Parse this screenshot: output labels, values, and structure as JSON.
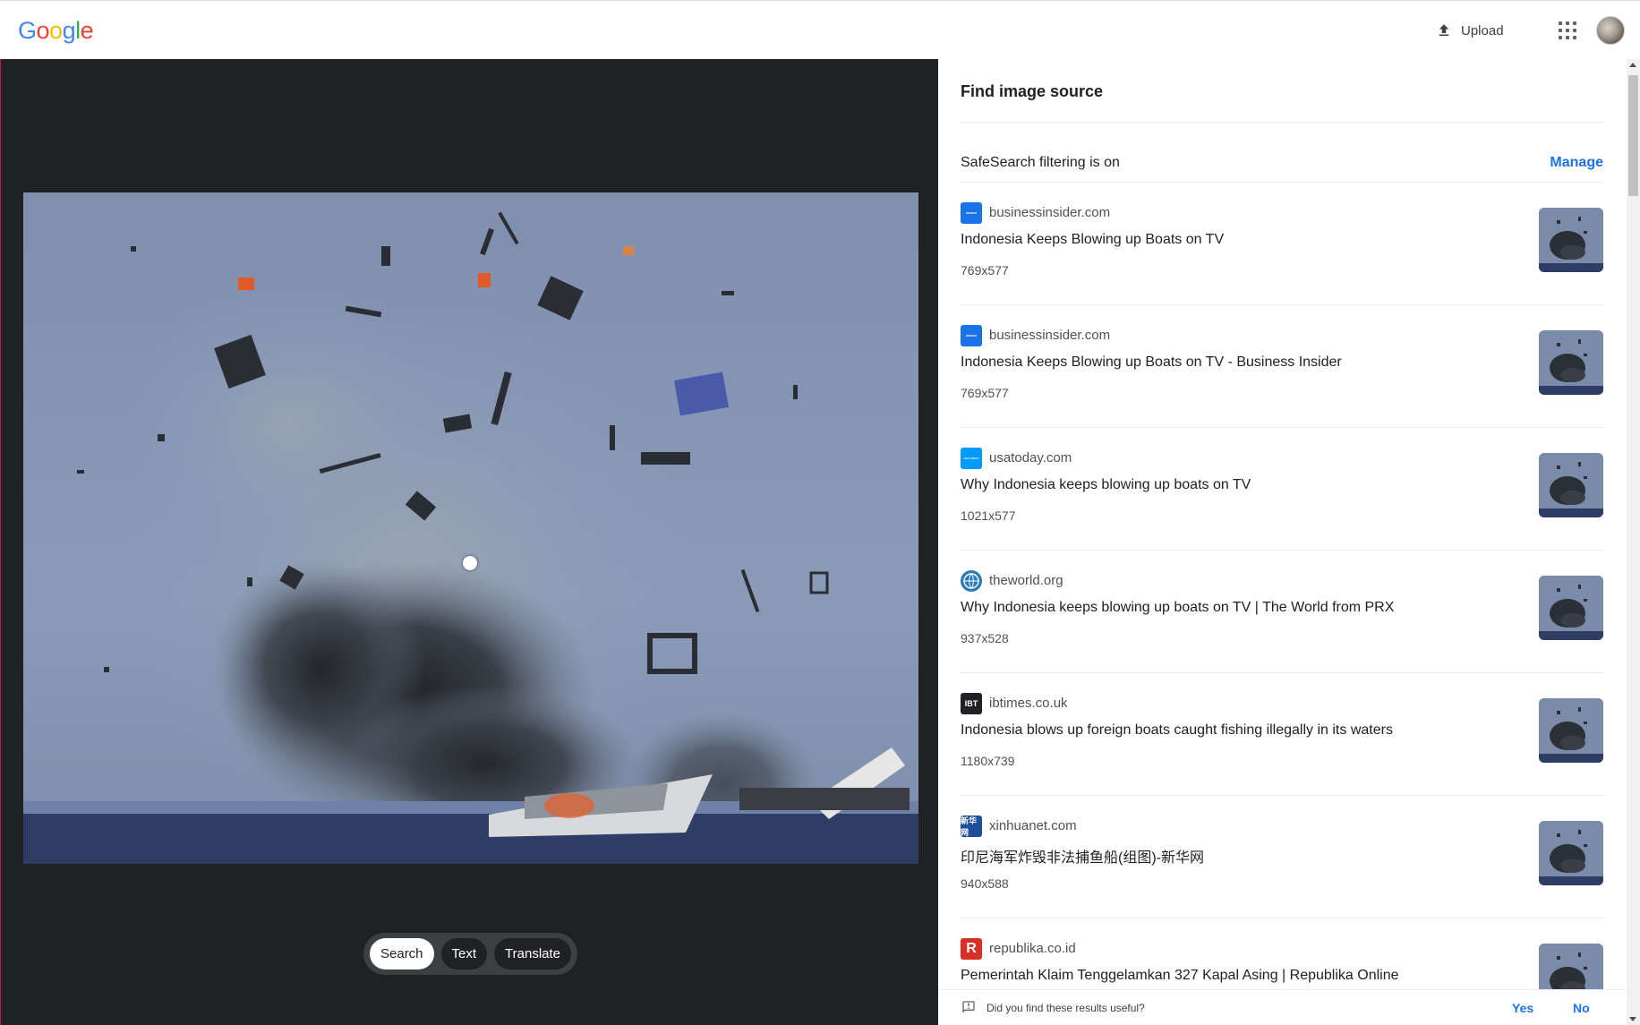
{
  "header": {
    "logo": [
      "G",
      "o",
      "o",
      "g",
      "l",
      "e"
    ],
    "logo_colors": [
      "#4285f4",
      "#ea4335",
      "#fbbc05",
      "#4285f4",
      "#34a853",
      "#ea4335"
    ],
    "upload_label": "Upload"
  },
  "viewer": {
    "modes": [
      "Search",
      "Text",
      "Translate"
    ],
    "active_mode": "Search"
  },
  "panel": {
    "title": "Find image source",
    "safesearch_label": "SafeSearch filtering is on",
    "manage_label": "Manage"
  },
  "results": [
    {
      "site": "businessinsider.com",
      "title": "Indonesia Keeps Blowing up Boats on TV",
      "dims": "769x577",
      "favicon_color": "#1a73e8",
      "favicon_text": "INSIDER"
    },
    {
      "site": "businessinsider.com",
      "title": "Indonesia Keeps Blowing up Boats on TV - Business Insider",
      "dims": "769x577",
      "favicon_color": "#1a73e8",
      "favicon_text": "INSIDER"
    },
    {
      "site": "usatoday.com",
      "title": "Why Indonesia keeps blowing up boats on TV",
      "dims": "1021x577",
      "favicon_color": "#009bff",
      "favicon_text": "USA TODAY"
    },
    {
      "site": "theworld.org",
      "title": "Why Indonesia keeps blowing up boats on TV | The World from PRX",
      "dims": "937x528",
      "favicon_color": "#2b7bb9",
      "favicon_text": ""
    },
    {
      "site": "ibtimes.co.uk",
      "title": "Indonesia blows up foreign boats caught fishing illegally in its waters",
      "dims": "1180x739",
      "favicon_color": "#202124",
      "favicon_text": "IBT"
    },
    {
      "site": "xinhuanet.com",
      "title": "印尼海军炸毁非法捕鱼船(组图)-新华网",
      "dims": "940x588",
      "favicon_color": "#1f4e9c",
      "favicon_text": "新华网"
    },
    {
      "site": "republika.co.id",
      "title": "Pemerintah Klaim Tenggelamkan 327 Kapal Asing | Republika Online",
      "dims": "",
      "favicon_color": "#d93025",
      "favicon_text": "R"
    }
  ],
  "feedback": {
    "question": "Did you find these results useful?",
    "yes": "Yes",
    "no": "No"
  }
}
